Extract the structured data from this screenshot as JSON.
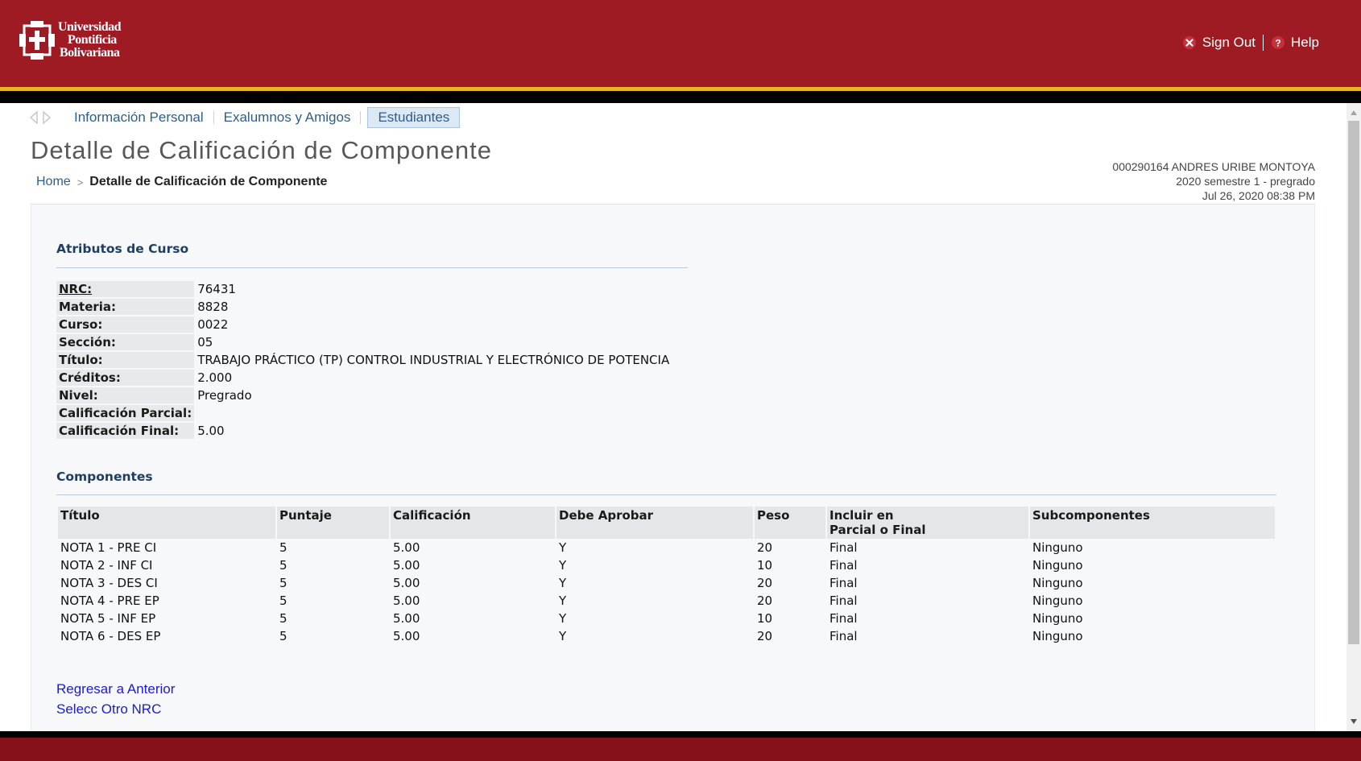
{
  "header": {
    "logo_lines": [
      "Universidad",
      "Pontificia",
      "Bolivariana"
    ],
    "sign_out_label": "Sign Out",
    "help_label": "Help"
  },
  "nav": {
    "tabs": [
      {
        "label": "Información Personal",
        "active": false
      },
      {
        "label": "Exalumnos y Amigos",
        "active": false
      },
      {
        "label": "Estudiantes",
        "active": true
      }
    ]
  },
  "page_title": "Detalle de Calificación de Componente",
  "breadcrumb": {
    "home": "Home",
    "separator": ">",
    "current": "Detalle de Calificación de Componente"
  },
  "user_info": {
    "line1": "000290164 ANDRES URIBE MONTOYA",
    "line2": "2020 semestre 1 - pregrado",
    "line3": "Jul 26, 2020 08:38 PM"
  },
  "course": {
    "section_title": "Atributos de Curso",
    "rows": [
      {
        "label": "NRC:",
        "value": "76431"
      },
      {
        "label": "Materia:",
        "value": "8828"
      },
      {
        "label": "Curso:",
        "value": "0022"
      },
      {
        "label": "Sección:",
        "value": "05"
      },
      {
        "label": "Título:",
        "value": "TRABAJO PRÁCTICO (TP) CONTROL INDUSTRIAL Y ELECTRÓNICO DE POTENCIA"
      },
      {
        "label": "Créditos:",
        "value": "2.000"
      },
      {
        "label": "Nivel:",
        "value": "Pregrado"
      },
      {
        "label": "Calificación Parcial:",
        "value": ""
      },
      {
        "label": "Calificación Final:",
        "value": "5.00"
      }
    ]
  },
  "components": {
    "section_title": "Componentes",
    "headers": [
      "Título",
      "Puntaje",
      "Calificación",
      "Debe Aprobar",
      "Peso",
      "Incluir en Parcial o Final",
      "Subcomponentes"
    ],
    "header_incluir_line1": "Incluir en",
    "header_incluir_line2": "Parcial o Final",
    "rows": [
      [
        "NOTA 1 - PRE CI",
        "5",
        "5.00",
        "Y",
        "20",
        "Final",
        "Ninguno"
      ],
      [
        "NOTA 2 - INF CI",
        "5",
        "5.00",
        "Y",
        "10",
        "Final",
        "Ninguno"
      ],
      [
        "NOTA 3 - DES CI",
        "5",
        "5.00",
        "Y",
        "20",
        "Final",
        "Ninguno"
      ],
      [
        "NOTA 4 - PRE EP",
        "5",
        "5.00",
        "Y",
        "20",
        "Final",
        "Ninguno"
      ],
      [
        "NOTA 5 - INF EP",
        "5",
        "5.00",
        "Y",
        "10",
        "Final",
        "Ninguno"
      ],
      [
        "NOTA 6 - DES EP",
        "5",
        "5.00",
        "Y",
        "20",
        "Final",
        "Ninguno"
      ]
    ]
  },
  "links": {
    "back": "Regresar a Anterior",
    "other_nrc": "Selecc Otro NRC"
  },
  "icons": {
    "sign_out": "close-icon",
    "help": "help-icon",
    "nav_back": "arrow-left-icon",
    "nav_forward": "arrow-right-icon"
  },
  "colors": {
    "header_red": "#9e1b24",
    "gold_stripe": "#e7b423",
    "footer_red": "#86111b",
    "link_blue": "#1a1ad9",
    "tab_blue": "#2f5d8a",
    "section_title": "#1e3e62"
  }
}
